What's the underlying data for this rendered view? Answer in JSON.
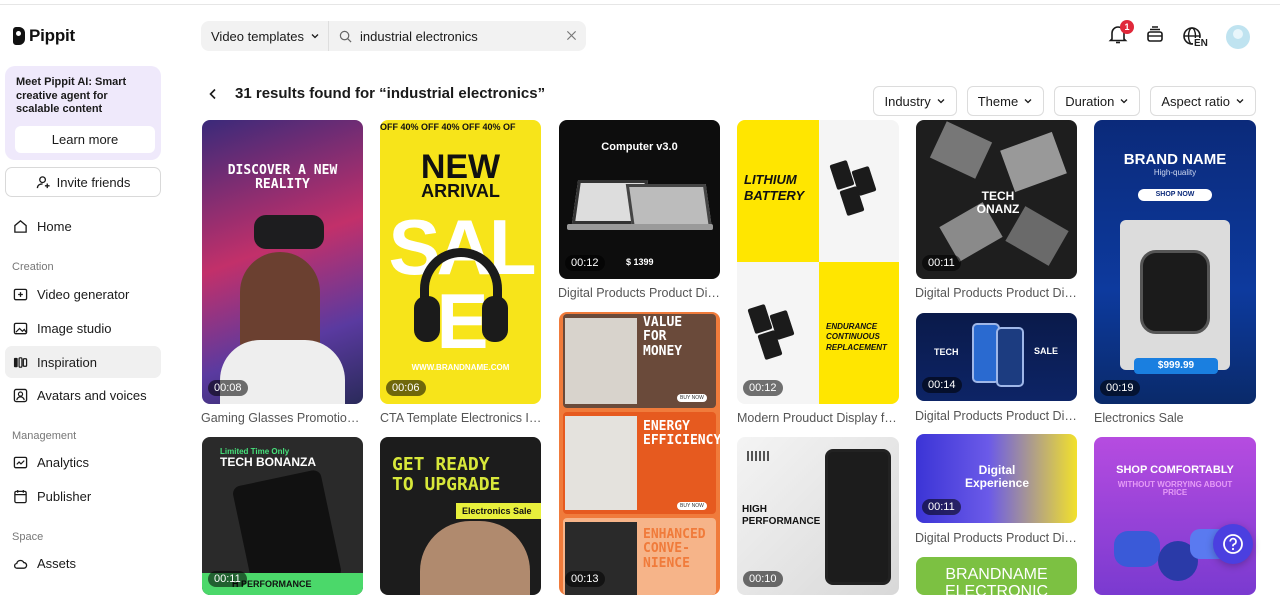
{
  "brand": {
    "name": "Pippit"
  },
  "promo": {
    "text": "Meet Pippit AI: Smart creative agent for scalable content",
    "button": "Learn more"
  },
  "invite": {
    "label": "Invite friends"
  },
  "nav": {
    "home": "Home",
    "creation_label": "Creation",
    "video_generator": "Video generator",
    "image_studio": "Image studio",
    "inspiration": "Inspiration",
    "avatars": "Avatars and voices",
    "management_label": "Management",
    "analytics": "Analytics",
    "publisher": "Publisher",
    "space_label": "Space",
    "assets": "Assets"
  },
  "search": {
    "category": "Video templates",
    "value": "industrial electronics"
  },
  "header": {
    "notification_count": "1",
    "language": "EN"
  },
  "results": {
    "title": "31 results found for “industrial electronics”"
  },
  "filters": [
    "Industry",
    "Theme",
    "Duration",
    "Aspect ratio"
  ],
  "cards": {
    "c1": {
      "duration": "00:08",
      "caption": "Gaming Glasses Promotion ...",
      "text": "DISCOVER A NEW REALITY"
    },
    "c2": {
      "duration": "00:06",
      "caption": "CTA Template Electronics In...",
      "banner": "OFF 40% OFF 40% OFF 40% OF",
      "title1": "NEW",
      "title2": "ARRIVAL",
      "sale": "SALE",
      "url": "WWW.BRANDNAME.COM"
    },
    "c3": {
      "duration": "00:12",
      "caption": "Digital Products Product Dis...",
      "title": "Computer v3.0",
      "price": "$ 1399"
    },
    "c4": {
      "duration": "00:12",
      "caption": "Modern Prouduct Display fo...",
      "title": "LITHIUM BATTERY",
      "sub": "ENDURANCE CONTINUOUS REPLACEMENT"
    },
    "c5": {
      "duration": "00:11",
      "caption": "Digital Products Product Dis...",
      "title": "TECH ONANZ"
    },
    "c6": {
      "duration": "00:19",
      "caption": "Electronics Sale",
      "title": "BRAND NAME",
      "sub": "High-quality",
      "btn": "SHOP NOW",
      "price": "$999.99"
    },
    "c7": {
      "duration": "00:13",
      "t1": "VALUE FOR MONEY",
      "t2": "ENERGY EFFICIENCY",
      "t3": "ENHANCED CONVE-NIENCE",
      "buy": "BUY NOW"
    },
    "c8": {
      "duration": "00:14",
      "caption": "Digital Products Product Dis...",
      "tech": "TECH",
      "sale": "SALE"
    },
    "c9": {
      "duration": "00:11",
      "tag": "Limited Time Only",
      "title": "TECH BONANZA",
      "bottom": "H PERFORMANCE"
    },
    "c10": {
      "title": "GET READY TO UPGRADE",
      "tag": "Electronics Sale"
    },
    "c11": {
      "duration": "00:10",
      "title": "HIGH PERFORMANCE"
    },
    "c12": {
      "duration": "00:11",
      "caption": "Digital Products Product Dis...",
      "title": "Digital Experience"
    },
    "c13": {
      "title": "SHOP COMFORTABLY",
      "sub": "WITHOUT WORRYING ABOUT PRICE"
    },
    "c14": {
      "title": "BRANDNAME ELECTRONIC"
    }
  }
}
